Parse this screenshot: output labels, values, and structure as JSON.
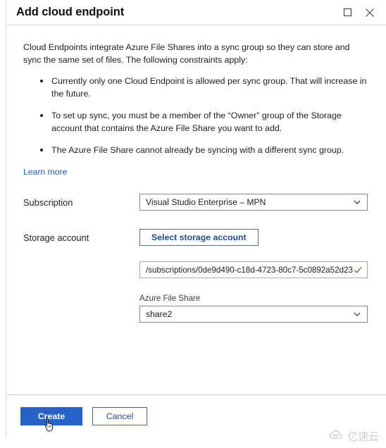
{
  "window": {
    "title": "Add cloud endpoint",
    "maximize_icon": "maximize-square-icon",
    "close_icon": "close-x-icon"
  },
  "body": {
    "intro": "Cloud Endpoints integrate Azure File Shares into a sync group so they can store and sync the same set of files. The following constraints apply:",
    "constraints": [
      "Currently only one Cloud Endpoint is allowed per sync group. That will increase in the future.",
      "To set up sync, you must be a member of the “Owner” group of the Storage account that contains the Azure File Share you want to add.",
      "The Azure File Share cannot already be syncing with a different sync group."
    ],
    "learn_more": "Learn more"
  },
  "form": {
    "subscription": {
      "label": "Subscription",
      "value": "Visual Studio Enterprise – MPN",
      "chevron_icon": "chevron-down-icon"
    },
    "storage_account": {
      "label": "Storage account",
      "button_label": "Select storage account",
      "path_value": "/subscriptions/0de9d490-c18d-4723-80c7-5c0892a52d23...",
      "valid_icon": "checkmark-icon"
    },
    "file_share": {
      "label": "Azure File Share",
      "value": "share2",
      "chevron_icon": "chevron-down-icon"
    }
  },
  "footer": {
    "create_label": "Create",
    "cancel_label": "Cancel"
  },
  "watermark": {
    "text": "亿速云",
    "icon": "cloud-icon"
  },
  "colors": {
    "primary_button": "#2563c8",
    "link": "#1c5fb3",
    "button_text_blue": "#1b4f9c",
    "check_green": "#5a8a3c"
  }
}
